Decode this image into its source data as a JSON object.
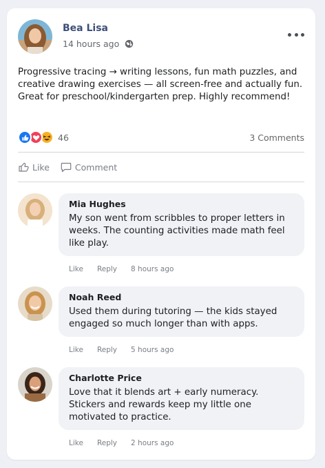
{
  "post": {
    "author": "Bea Lisa",
    "time": "14 hours ago",
    "privacy_icon": "globe-icon",
    "text": "Progressive tracing → writing lessons, fun math puzzles, and creative drawing exercises — all screen-free and actually fun. Great for preschool/kindergarten prep. Highly recommend!",
    "reaction_count": "46",
    "reactions": [
      "like",
      "love",
      "haha"
    ],
    "comment_count": "3 Comments"
  },
  "actions": {
    "like": "Like",
    "comment": "Comment"
  },
  "comments": [
    {
      "name": "Mia Hughes",
      "text": "My son went from scribbles to proper letters in weeks. The counting activities made math feel like play.",
      "like": "Like",
      "reply": "Reply",
      "time": "8 hours ago"
    },
    {
      "name": "Noah Reed",
      "text": "Used them during tutoring — the kids stayed engaged so much longer than with apps.",
      "like": "Like",
      "reply": "Reply",
      "time": "5 hours ago"
    },
    {
      "name": "Charlotte Price",
      "text": "Love that it blends art + early numeracy. Stickers and rewards keep my little one motivated to practice.",
      "like": "Like",
      "reply": "Reply",
      "time": "2 hours ago"
    }
  ],
  "colors": {
    "author_name": "#3d4f7a",
    "like_reaction": "#1877f2",
    "love_reaction": "#f33e58",
    "haha_reaction": "#f7b125",
    "bubble_bg": "#f0f2f5"
  }
}
